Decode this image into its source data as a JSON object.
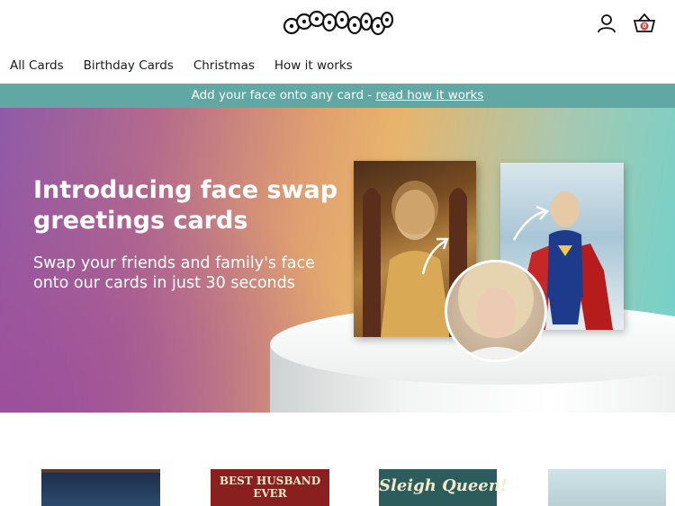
{
  "header": {
    "logo_text": "LOOKALIKES",
    "account_icon": "user-icon",
    "basket_icon": "basket-icon",
    "basket_count": "0"
  },
  "nav": {
    "items": [
      {
        "label": "All Cards"
      },
      {
        "label": "Birthday Cards"
      },
      {
        "label": "Christmas"
      },
      {
        "label": "How it works"
      }
    ]
  },
  "banner": {
    "text": "Add your face onto any card - ",
    "link": "read how it works"
  },
  "hero": {
    "title": "Introducing face swap greetings cards",
    "subtitle": "Swap your friends and family's face onto our cards in just 30 seconds"
  },
  "products": [
    {
      "card_text": ""
    },
    {
      "card_text": "BEST HUSBAND EVER"
    },
    {
      "card_text": "Sleigh Queen!"
    },
    {
      "card_text": ""
    }
  ],
  "colors": {
    "banner_bg": "#61a7a4",
    "basket_accent": "#e53935"
  }
}
